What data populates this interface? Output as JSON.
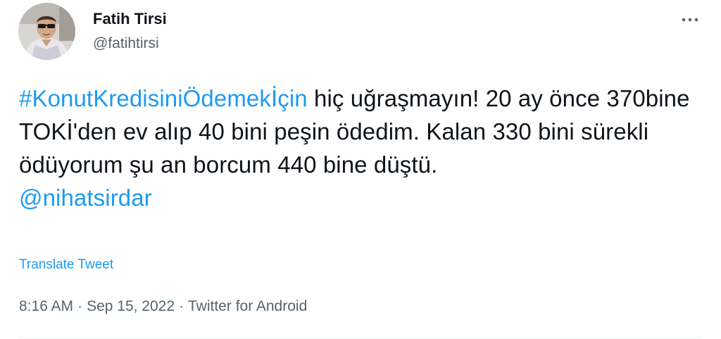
{
  "author": {
    "display_name": "Fatih Tirsi",
    "handle": "@fatihtirsi",
    "avatar_icon": "profile-photo"
  },
  "menu": {
    "icon": "more-horizontal-icon"
  },
  "tweet": {
    "hashtag": "#KonutKredisiniÖdemekİçin",
    "text": " hiç uğraşmayın! 20 ay önce 370bine TOKİ'den ev alıp 40 bini peşin ödedim. Kalan 330 bini sürekli ödüyorum şu an borcum 440 bine düştü.",
    "mention": "@nihatsirdar"
  },
  "translate_label": "Translate Tweet",
  "meta": {
    "time": "8:16 AM",
    "separator": "·",
    "date": "Sep 15, 2022",
    "source": "Twitter for Android"
  },
  "colors": {
    "link": "#1d9bf0",
    "text": "#0f1419",
    "secondary": "#536471"
  }
}
